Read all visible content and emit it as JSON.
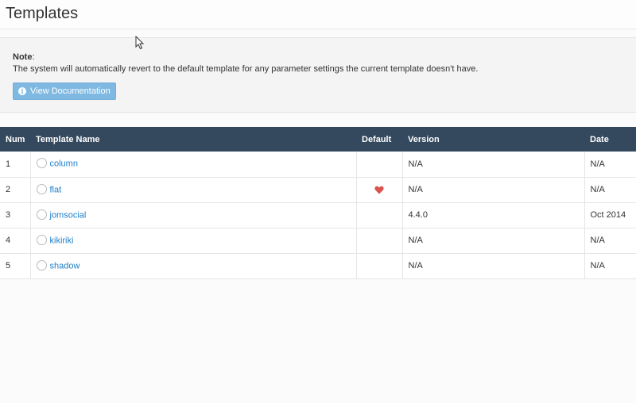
{
  "header": {
    "title": "Templates"
  },
  "note": {
    "label": "Note",
    "text": "The system will automatically revert to the default template for any parameter settings the current template doesn't have.",
    "button_label": "View Documentation",
    "button_icon": "info-icon"
  },
  "table": {
    "columns": {
      "num": "Num",
      "name": "Template Name",
      "default": "Default",
      "version": "Version",
      "date": "Date"
    },
    "rows": [
      {
        "num": "1",
        "name": "column",
        "is_default": false,
        "version": "N/A",
        "date": "N/A"
      },
      {
        "num": "2",
        "name": "flat",
        "is_default": true,
        "version": "N/A",
        "date": "N/A"
      },
      {
        "num": "3",
        "name": "jomsocial",
        "is_default": false,
        "version": "4.4.0",
        "date": "Oct 2014"
      },
      {
        "num": "4",
        "name": "kikiriki",
        "is_default": false,
        "version": "N/A",
        "date": "N/A"
      },
      {
        "num": "5",
        "name": "shadow",
        "is_default": false,
        "version": "N/A",
        "date": "N/A"
      }
    ]
  },
  "colors": {
    "header_bg": "#34495e",
    "link": "#1e7ec8",
    "button_bg": "#7fb9e2",
    "heart": "#d9534f"
  }
}
